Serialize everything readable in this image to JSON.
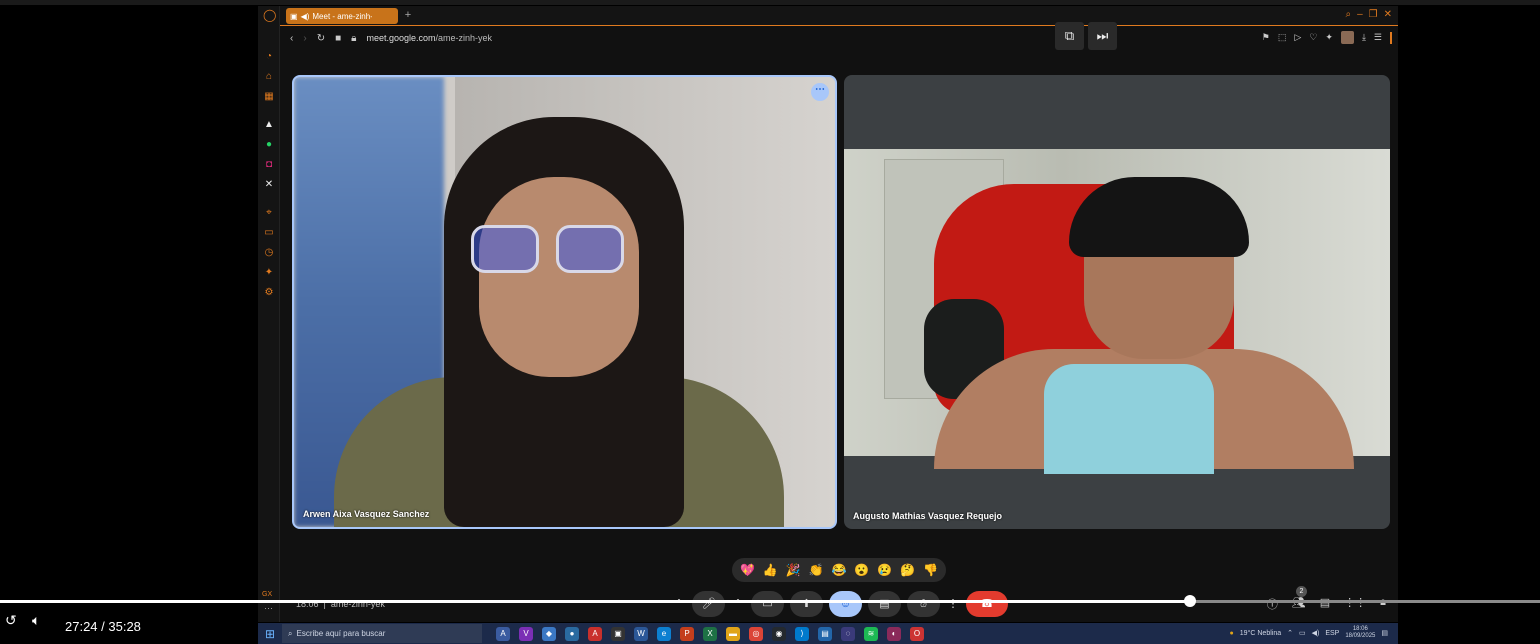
{
  "browser": {
    "tab_title": "Meet - ame-zinh-yek",
    "url_host": "meet.google.com",
    "url_path": "/ame-zinh-yek",
    "sidebar_label": "GX"
  },
  "meet": {
    "participants": [
      {
        "name": "Arwen Aixa Vasquez Sanchez"
      },
      {
        "name": "Augusto Mathias Vasquez Requejo"
      }
    ],
    "reactions": [
      "💖",
      "👍",
      "🎉",
      "👏",
      "😂",
      "😮",
      "😢",
      "🤔",
      "👎"
    ],
    "footer_time": "18:06",
    "footer_code": "ame-zinh-yek",
    "people_count": "2"
  },
  "player": {
    "current_time": "27:24",
    "duration": "35:28",
    "time_display": "27:24 / 35:28",
    "progress": 0.7725
  },
  "taskbar": {
    "search_placeholder": "Escribe aquí para buscar",
    "weather": "19°C  Neblina",
    "lang": "ESP",
    "clock_time": "18:06",
    "clock_date": "18/09/2025"
  },
  "icons": {
    "pip": "external-window-icon",
    "skip": "skip-next-icon"
  },
  "colors": {
    "accent_opera": "#e07a1f",
    "speaking_border": "#a8c7fa",
    "end_call": "#e33b2e"
  }
}
